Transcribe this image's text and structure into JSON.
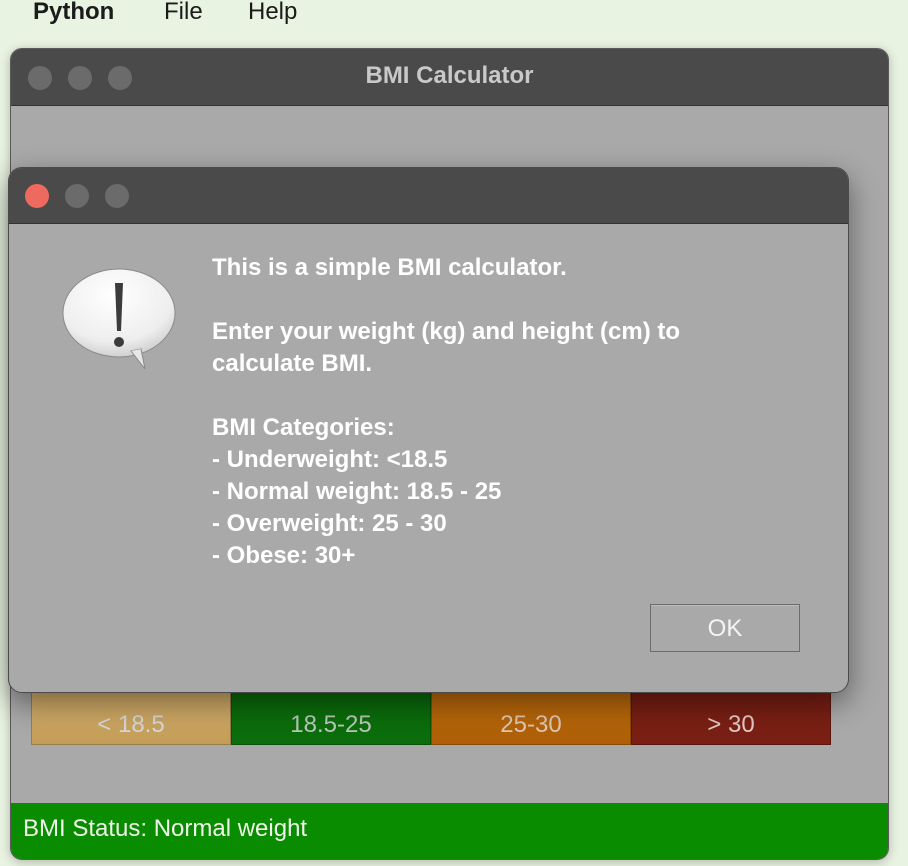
{
  "menubar": {
    "app_name": "Python",
    "items": [
      "File",
      "Help"
    ]
  },
  "main_window": {
    "title": "BMI Calculator",
    "bmi_scale": [
      {
        "label": "< 18.5",
        "color": "#d8b36f"
      },
      {
        "label": "18.5-25",
        "color": "#0b6d0b"
      },
      {
        "label": "25-30",
        "color": "#c16d0c"
      },
      {
        "label": "> 30",
        "color": "#7a1f14"
      }
    ],
    "status": {
      "text": "BMI Status: Normal weight",
      "color": "#0a8c00"
    }
  },
  "dialog": {
    "icon": "exclamation-speech-bubble-icon",
    "message": {
      "intro": "This is a simple BMI calculator.",
      "instruction_line1": "Enter your weight (kg) and height (cm) to",
      "instruction_line2": "calculate BMI.",
      "categories_heading": "BMI Categories:",
      "categories": [
        "- Underweight: <18.5",
        "- Normal weight: 18.5 - 25",
        "- Overweight: 25 - 30",
        "- Obese: 30+"
      ]
    },
    "ok_label": "OK"
  },
  "colors": {
    "window_bg": "#a9a9a9",
    "titlebar_bg": "#4a4a4a",
    "close_button": "#ee6a5e",
    "inactive_traffic_light": "#6b6b6b"
  }
}
